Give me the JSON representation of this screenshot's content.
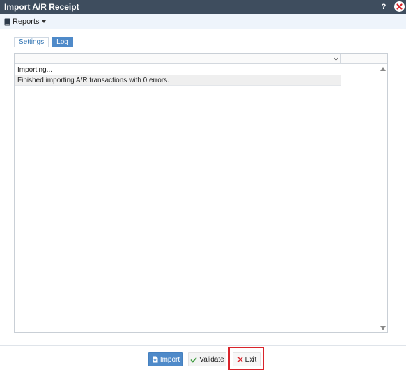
{
  "window": {
    "title": "Import A/R Receipt",
    "help_label": "?"
  },
  "toolbar": {
    "reports_label": "Reports"
  },
  "tabs": [
    {
      "label": "Settings",
      "active": false
    },
    {
      "label": "Log",
      "active": true
    }
  ],
  "log": {
    "rows": [
      "Importing...",
      "Finished importing A/R transactions with 0 errors."
    ]
  },
  "buttons": {
    "import_label": "Import",
    "validate_label": "Validate",
    "exit_label": "Exit"
  },
  "colors": {
    "titlebar": "#3e4d5e",
    "accent": "#4f8ac9",
    "highlight": "#d9242b",
    "validate_check": "#3a9a3a",
    "exit_x": "#d9242b"
  },
  "icons": {
    "reports": "book-icon",
    "import": "import-icon",
    "validate": "checkmark-icon",
    "exit": "x-icon",
    "close": "close-icon"
  }
}
